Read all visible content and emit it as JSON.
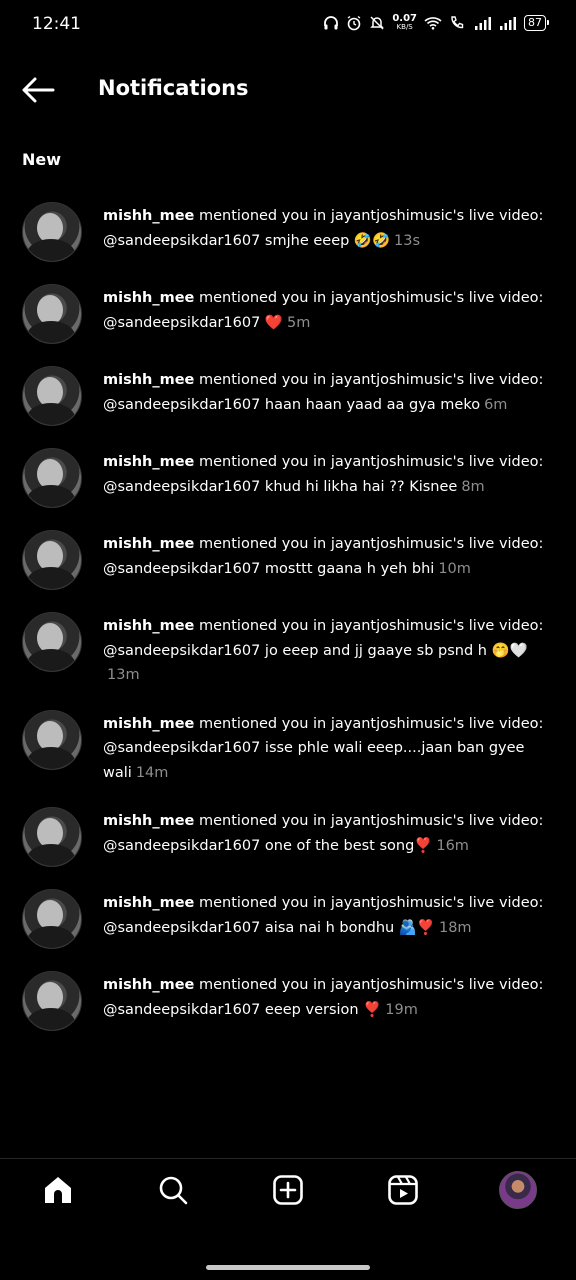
{
  "status_bar": {
    "time": "12:41",
    "net_speed": "0.07",
    "net_unit": "KB/S",
    "battery": "87"
  },
  "header": {
    "title": "Notifications"
  },
  "section": {
    "label": "New"
  },
  "notifications": [
    {
      "user": "mishh_mee",
      "action": " mentioned you in jayantjoshimusic's live video:",
      "mention": "@sandeepsikdar1607",
      "comment": "smjhe eeep 🤣🤣",
      "time": "13s"
    },
    {
      "user": "mishh_mee",
      "action": " mentioned you in jayantjoshimusic's live video:",
      "mention": "@sandeepsikdar1607",
      "comment": "❤️",
      "time": "5m"
    },
    {
      "user": "mishh_mee",
      "action": " mentioned you in jayantjoshimusic's live video:",
      "mention": "@sandeepsikdar1607",
      "comment": "haan haan yaad aa gya meko",
      "time": "6m"
    },
    {
      "user": "mishh_mee",
      "action": " mentioned you in jayantjoshimusic's live video:",
      "mention": "@sandeepsikdar1607",
      "comment": "khud hi likha hai ?? Kisnee",
      "time": "8m"
    },
    {
      "user": "mishh_mee",
      "action": " mentioned you in jayantjoshimusic's live video:",
      "mention": "@sandeepsikdar1607",
      "comment": "mosttt gaana h yeh bhi",
      "time": "10m"
    },
    {
      "user": "mishh_mee",
      "action": " mentioned you in jayantjoshimusic's live video:",
      "mention": "@sandeepsikdar1607",
      "comment": "jo eeep and jj gaaye sb psnd h 🤭🤍",
      "time": "13m"
    },
    {
      "user": "mishh_mee",
      "action": " mentioned you in jayantjoshimusic's live video:",
      "mention": "@sandeepsikdar1607",
      "comment": "isse phle wali eeep....jaan ban gyee wali",
      "time": "14m"
    },
    {
      "user": "mishh_mee",
      "action": " mentioned you in jayantjoshimusic's live video:",
      "mention": "@sandeepsikdar1607",
      "comment": "one of the best song❣️",
      "time": "16m"
    },
    {
      "user": "mishh_mee",
      "action": " mentioned you in jayantjoshimusic's live video:",
      "mention": "@sandeepsikdar1607",
      "comment": "aisa nai h bondhu 🫂❣️",
      "time": "18m"
    },
    {
      "user": "mishh_mee",
      "action": " mentioned you in jayantjoshimusic's live video:",
      "mention": "@sandeepsikdar1607",
      "comment": "eeep version ❣️",
      "time": "19m"
    }
  ],
  "bottom_nav": {
    "items": [
      {
        "icon": "home-icon",
        "active": true
      },
      {
        "icon": "search-icon"
      },
      {
        "icon": "create-post-icon"
      },
      {
        "icon": "reels-icon"
      },
      {
        "icon": "profile-avatar"
      }
    ]
  }
}
